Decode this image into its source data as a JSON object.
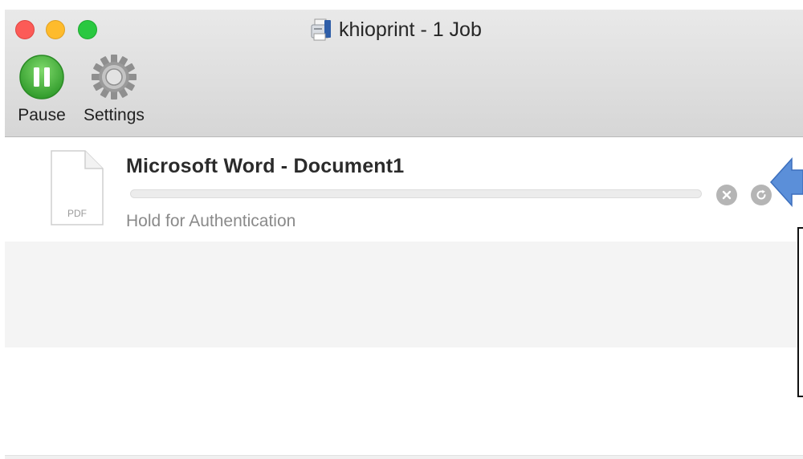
{
  "window": {
    "title": "khioprint - 1 Job",
    "title_icon": "printer-icon"
  },
  "traffic_lights": {
    "close_color": "#fc5b57",
    "minimize_color": "#febb2c",
    "zoom_color": "#29c840"
  },
  "toolbar": {
    "pause_label": "Pause",
    "pause_icon": "pause-icon",
    "pause_color": "#3fae3a",
    "settings_label": "Settings",
    "settings_icon": "gear-icon"
  },
  "jobs": [
    {
      "name": "Microsoft Word - Document1",
      "file_type": "PDF",
      "status": "Hold for Authentication",
      "progress": 0,
      "actions": [
        "cancel-icon",
        "resume-icon"
      ]
    }
  ],
  "annotation": {
    "arrow_color": "#5b8fd9"
  }
}
